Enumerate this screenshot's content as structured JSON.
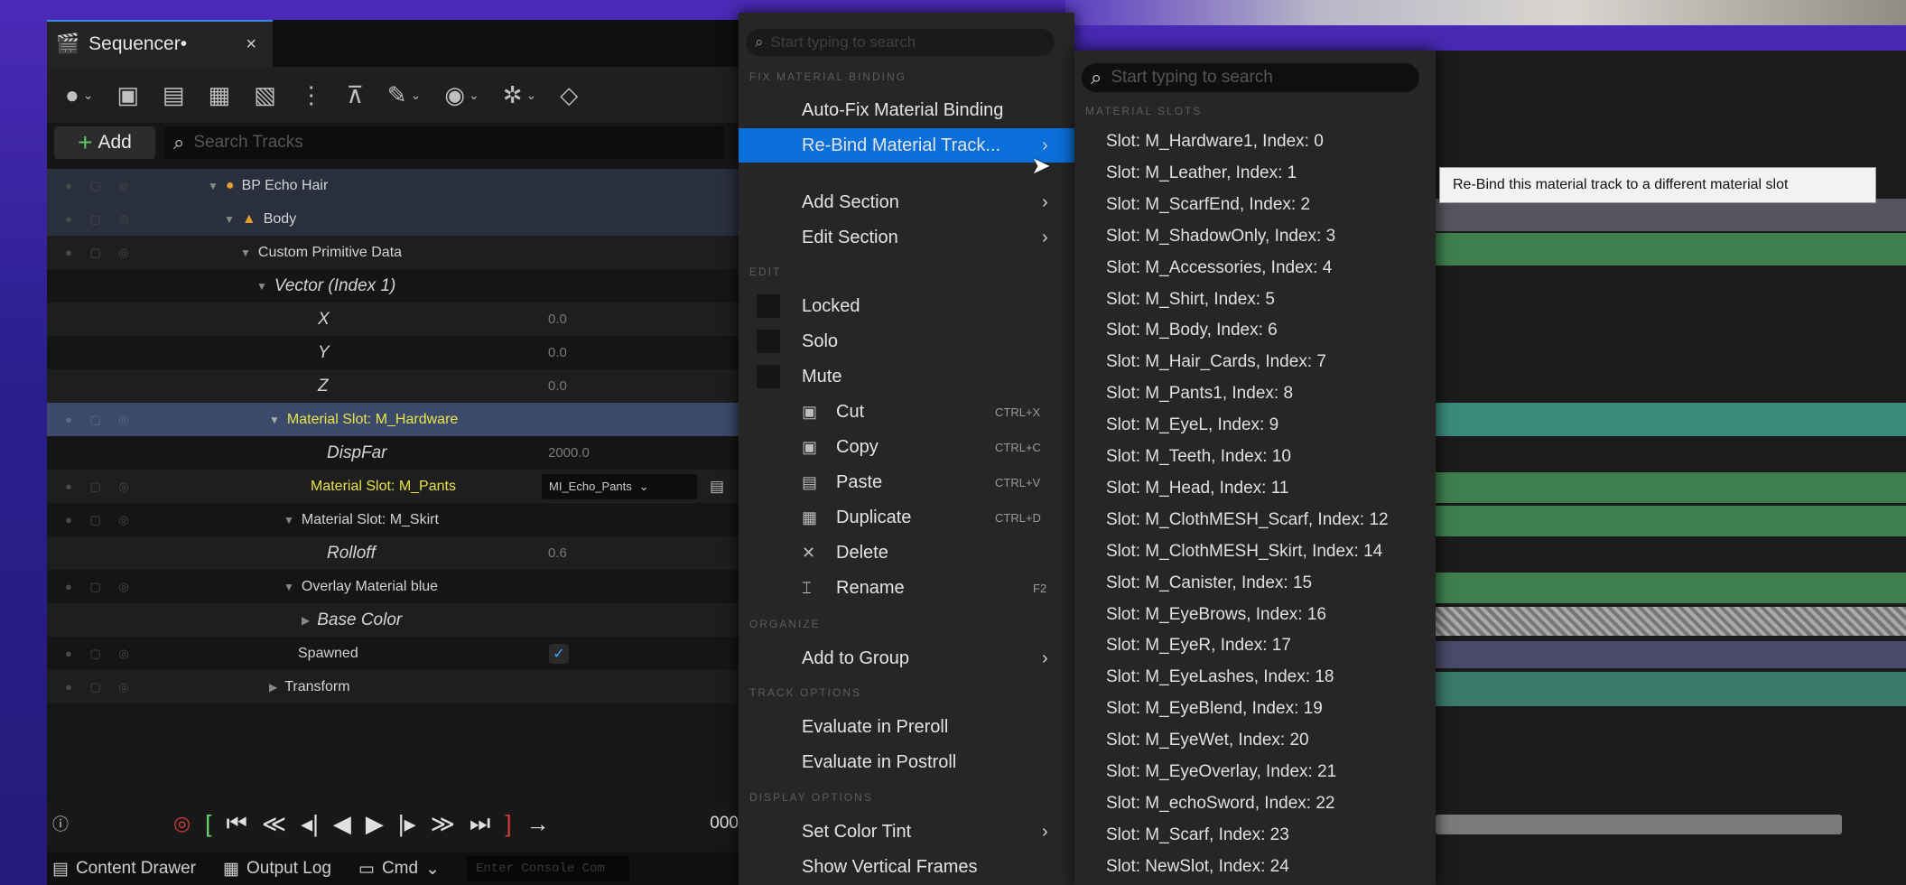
{
  "sequencer": {
    "tab_label": "Sequencer•",
    "tab_close": "×",
    "add_label": "Add",
    "search_placeholder": "Search Tracks"
  },
  "tracks": [
    {
      "name": "BP Echo Hair",
      "value": ""
    },
    {
      "name": "Body",
      "value": ""
    },
    {
      "name": "Custom Primitive Data",
      "value": ""
    },
    {
      "name": "Vector (Index 1)",
      "value": ""
    },
    {
      "name": "X",
      "value": "0.0"
    },
    {
      "name": "Y",
      "value": "0.0"
    },
    {
      "name": "Z",
      "value": "0.0"
    },
    {
      "name": "Material Slot: M_Hardware",
      "value": ""
    },
    {
      "name": "DispFar",
      "value": "2000.0"
    },
    {
      "name": "Material Slot: M_Pants",
      "value": "MI_Echo_Pants"
    },
    {
      "name": "Material Slot: M_Skirt",
      "value": ""
    },
    {
      "name": "Rolloff",
      "value": "0.6"
    },
    {
      "name": "Overlay Material blue",
      "value": ""
    },
    {
      "name": "Base Color",
      "value": ""
    },
    {
      "name": "Spawned",
      "value": ""
    },
    {
      "name": "Transform",
      "value": ""
    }
  ],
  "context_menu": {
    "search_placeholder": "Start typing to search",
    "sections": {
      "fix": "FIX MATERIAL BINDING",
      "edit": "EDIT",
      "organize": "ORGANIZE",
      "track_options": "TRACK OPTIONS",
      "display_options": "DISPLAY OPTIONS"
    },
    "items": {
      "auto_fix": "Auto-Fix Material Binding",
      "rebind": "Re-Bind Material Track...",
      "add_section": "Add Section",
      "edit_section": "Edit Section",
      "locked": "Locked",
      "solo": "Solo",
      "mute": "Mute",
      "cut": "Cut",
      "cut_sc": "CTRL+X",
      "copy": "Copy",
      "copy_sc": "CTRL+C",
      "paste": "Paste",
      "paste_sc": "CTRL+V",
      "duplicate": "Duplicate",
      "duplicate_sc": "CTRL+D",
      "delete": "Delete",
      "rename": "Rename",
      "rename_sc": "F2",
      "add_to_group": "Add to Group",
      "eval_preroll": "Evaluate in Preroll",
      "eval_postroll": "Evaluate in Postroll",
      "set_color_tint": "Set Color Tint",
      "show_vertical_frames": "Show Vertical Frames"
    }
  },
  "sub_menu": {
    "search_placeholder": "Start typing to search",
    "section": "MATERIAL SLOTS",
    "slots": [
      "Slot: M_Hardware1, Index: 0",
      "Slot: M_Leather, Index: 1",
      "Slot: M_ScarfEnd, Index: 2",
      "Slot: M_ShadowOnly, Index: 3",
      "Slot: M_Accessories, Index: 4",
      "Slot: M_Shirt, Index: 5",
      "Slot: M_Body, Index: 6",
      "Slot: M_Hair_Cards, Index: 7",
      "Slot: M_Pants1, Index: 8",
      "Slot: M_EyeL, Index: 9",
      "Slot: M_Teeth, Index: 10",
      "Slot: M_Head, Index: 11",
      "Slot: M_ClothMESH_Scarf, Index: 12",
      "Slot: M_ClothMESH_Skirt, Index: 14",
      "Slot: M_Canister, Index: 15",
      "Slot: M_EyeBrows, Index: 16",
      "Slot: M_EyeR, Index: 17",
      "Slot: M_EyeLashes, Index: 18",
      "Slot: M_EyeBlend, Index: 19",
      "Slot: M_EyeWet, Index: 20",
      "Slot: M_EyeOverlay, Index: 21",
      "Slot: M_echoSword, Index: 22",
      "Slot: M_Scarf, Index: 23",
      "Slot: NewSlot, Index: 24"
    ]
  },
  "tooltip": "Re-Bind this material track to a different material slot",
  "transport": {
    "frame": "000"
  },
  "statusbar": {
    "content_drawer": "Content Drawer",
    "output_log": "Output Log",
    "cmd": "Cmd",
    "console_placeholder": "Enter Console Com"
  },
  "colors": {
    "accent": "#0a6fd8",
    "highlight_yellow": "#e8e54a",
    "track_green": "#3f7f4e",
    "track_teal": "#3a8a7a"
  }
}
